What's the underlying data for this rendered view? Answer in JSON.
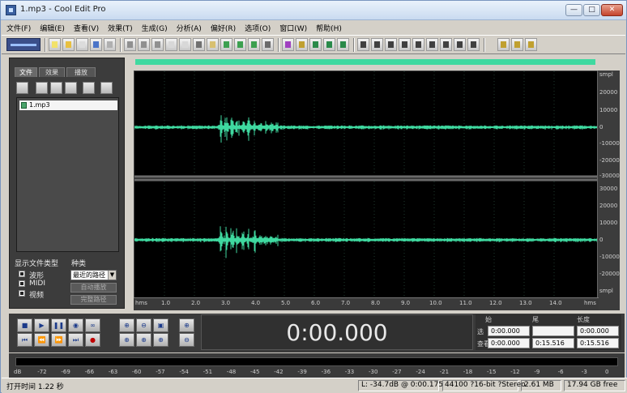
{
  "window": {
    "title": "1.mp3 - Cool Edit Pro"
  },
  "menu": [
    "文件(F)",
    "编辑(E)",
    "查看(V)",
    "效果(T)",
    "生成(G)",
    "分析(A)",
    "偏好(R)",
    "选项(O)",
    "窗口(W)",
    "帮助(H)"
  ],
  "left_panel": {
    "tabs": [
      "文件",
      "效果",
      "播放"
    ],
    "files": [
      "1.mp3"
    ],
    "show_type_label": "显示文件类型",
    "types": [
      "波形",
      "MIDI",
      "视频"
    ],
    "sort_label": "种类",
    "sort_value": "最近的路径",
    "btn_play": "自动播放",
    "btn_full": "完整路径"
  },
  "ruler": [
    "smpl",
    "20000",
    "10000",
    "0",
    "-10000",
    "-20000",
    "-30000",
    "30000",
    "20000",
    "10000",
    "0",
    "-10000",
    "-20000",
    "smpl"
  ],
  "timeline": [
    "hms",
    "1.0",
    "2.0",
    "3.0",
    "4.0",
    "5.0",
    "6.0",
    "7.0",
    "8.0",
    "9.0",
    "10.0",
    "11.0",
    "12.0",
    "13.0",
    "14.0",
    "hms"
  ],
  "transport": {
    "time": "0:00.000"
  },
  "selection": {
    "col_begin": "始",
    "col_end": "尾",
    "col_length": "长度",
    "row_select": "选",
    "row_view": "查看",
    "sel_begin": "0:00.000",
    "sel_end": "",
    "sel_length": "0:00.000",
    "view_begin": "0:00.000",
    "view_end": "0:15.516",
    "view_length": "0:15.516"
  },
  "meter_scale": [
    "dB",
    "-72",
    "-69",
    "-66",
    "-63",
    "-60",
    "-57",
    "-54",
    "-51",
    "-48",
    "-45",
    "-42",
    "-39",
    "-36",
    "-33",
    "-30",
    "-27",
    "-24",
    "-21",
    "-18",
    "-15",
    "-12",
    "-9",
    "-6",
    "-3",
    "0"
  ],
  "status": {
    "open_time": "打开时间 1.22 秒",
    "level": "L: -34.7dB @  0:00.175",
    "format": "44100 ?16-bit ?Stereo",
    "size": "2.61 MB",
    "free": "17.94 GB free"
  },
  "colors": {
    "waveform": "#3fd9a0",
    "overview": "#3fd9a0"
  }
}
